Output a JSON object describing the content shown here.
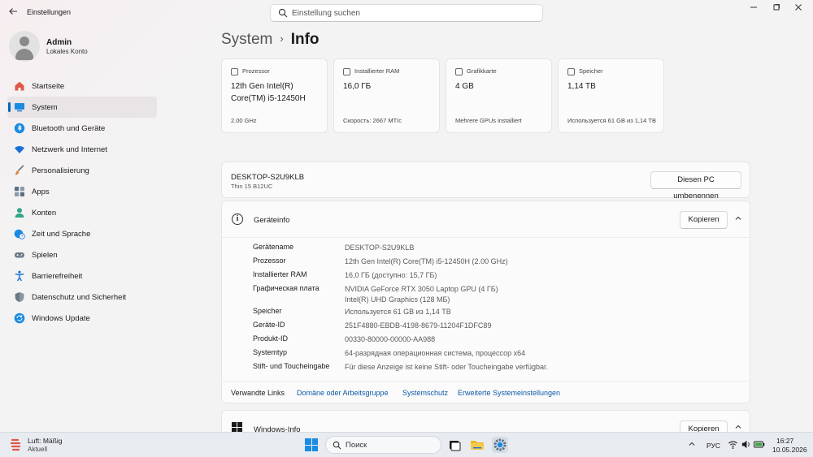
{
  "window": {
    "title": "Einstellungen",
    "back_icon": "arrow-left-icon",
    "controls": [
      "minimize-icon",
      "maximize-icon",
      "close-icon"
    ]
  },
  "search": {
    "placeholder": "Einstellung suchen"
  },
  "profile": {
    "name": "Admin",
    "account": "Lokales Konto"
  },
  "sidebar": {
    "items": [
      {
        "label": "Startseite",
        "icon": "home-icon",
        "color": "#e0574a"
      },
      {
        "label": "System",
        "icon": "monitor-icon",
        "color": "#1a8be0",
        "active": true
      },
      {
        "label": "Bluetooth und Geräte",
        "icon": "bluetooth-icon",
        "color": "#1a8be0"
      },
      {
        "label": "Netzwerk und Internet",
        "icon": "wifi-icon",
        "color": "#1a6fd4"
      },
      {
        "label": "Personalisierung",
        "icon": "brush-icon",
        "color": "#e08a3a"
      },
      {
        "label": "Apps",
        "icon": "apps-icon",
        "color": "#5a6f86"
      },
      {
        "label": "Konten",
        "icon": "person-icon",
        "color": "#2fa58a"
      },
      {
        "label": "Zeit und Sprache",
        "icon": "globe-clock-icon",
        "color": "#1a8be0"
      },
      {
        "label": "Spielen",
        "icon": "gamepad-icon",
        "color": "#6b7785"
      },
      {
        "label": "Barrierefreiheit",
        "icon": "accessibility-icon",
        "color": "#1a6fd4"
      },
      {
        "label": "Datenschutz und Sicherheit",
        "icon": "shield-icon",
        "color": "#6b7785"
      },
      {
        "label": "Windows Update",
        "icon": "update-icon",
        "color": "#1a8be0"
      }
    ]
  },
  "breadcrumb": {
    "parent": "System",
    "separator": "›",
    "current": "Info"
  },
  "cards": [
    {
      "title": "Prozessor",
      "value": "12th Gen Intel(R) Core(TM) i5-12450H",
      "sub": "2.00 GHz",
      "icon": "cpu-icon"
    },
    {
      "title": "Installierter RAM",
      "value": "16,0 ГБ",
      "sub": "Скорость: 2667 MT/c",
      "icon": "ram-icon"
    },
    {
      "title": "Grafikkarte",
      "value": "4 GB",
      "sub": "Mehrere GPUs installiert",
      "icon": "gpu-icon"
    },
    {
      "title": "Speicher",
      "value": "1,14 TB",
      "sub": "Используется 61 GB из 1,14 TB",
      "icon": "storage-icon"
    }
  ],
  "pc": {
    "name": "DESKTOP-S2U9KLB",
    "model": "Thin 15 B12UC",
    "rename_label": "Diesen PC umbenennen"
  },
  "device_info": {
    "title": "Geräteinfo",
    "copy_label": "Kopieren",
    "rows": [
      {
        "label": "Gerätename",
        "value": "DESKTOP-S2U9KLB"
      },
      {
        "label": "Prozessor",
        "value": "12th Gen Intel(R) Core(TM) i5-12450H (2.00 GHz)"
      },
      {
        "label": "Installierter RAM",
        "value": "16,0 ГБ (доступно: 15,7 ГБ)"
      },
      {
        "label": "Графическая плата",
        "value": "NVIDIA GeForce RTX 3050 Laptop GPU (4 ГБ)",
        "value2": "Intel(R) UHD Graphics (128 МБ)"
      },
      {
        "label": "Speicher",
        "value": "Используется 61 GB из 1,14 TB"
      },
      {
        "label": "Geräte-ID",
        "value": "251F4880-EBDB-4198-8679-11204F1DFC89"
      },
      {
        "label": "Produkt-ID",
        "value": "00330-80000-00000-AA988"
      },
      {
        "label": "Systemtyp",
        "value": "64-разрядная операционная система, процессор x64"
      },
      {
        "label": "Stift- und Toucheingabe",
        "value": "Für diese Anzeige ist keine Stift- oder Toucheingabe verfügbar."
      }
    ],
    "related": {
      "label": "Verwandte Links",
      "links": [
        "Domäne oder Arbeitsgruppe",
        "Systemschutz",
        "Erweiterte Systemeinstellungen"
      ]
    }
  },
  "windows_info": {
    "title": "Windows-Info",
    "copy_label": "Kopieren"
  },
  "taskbar": {
    "weather_title": "Luft: Mäßig",
    "weather_sub": "Aktuell",
    "search_label": "Поиск",
    "language": "РУС",
    "time": "16:27",
    "date": "10.05.2026"
  },
  "colors": {
    "accent": "#0067c0",
    "link": "#0e5aa7"
  }
}
